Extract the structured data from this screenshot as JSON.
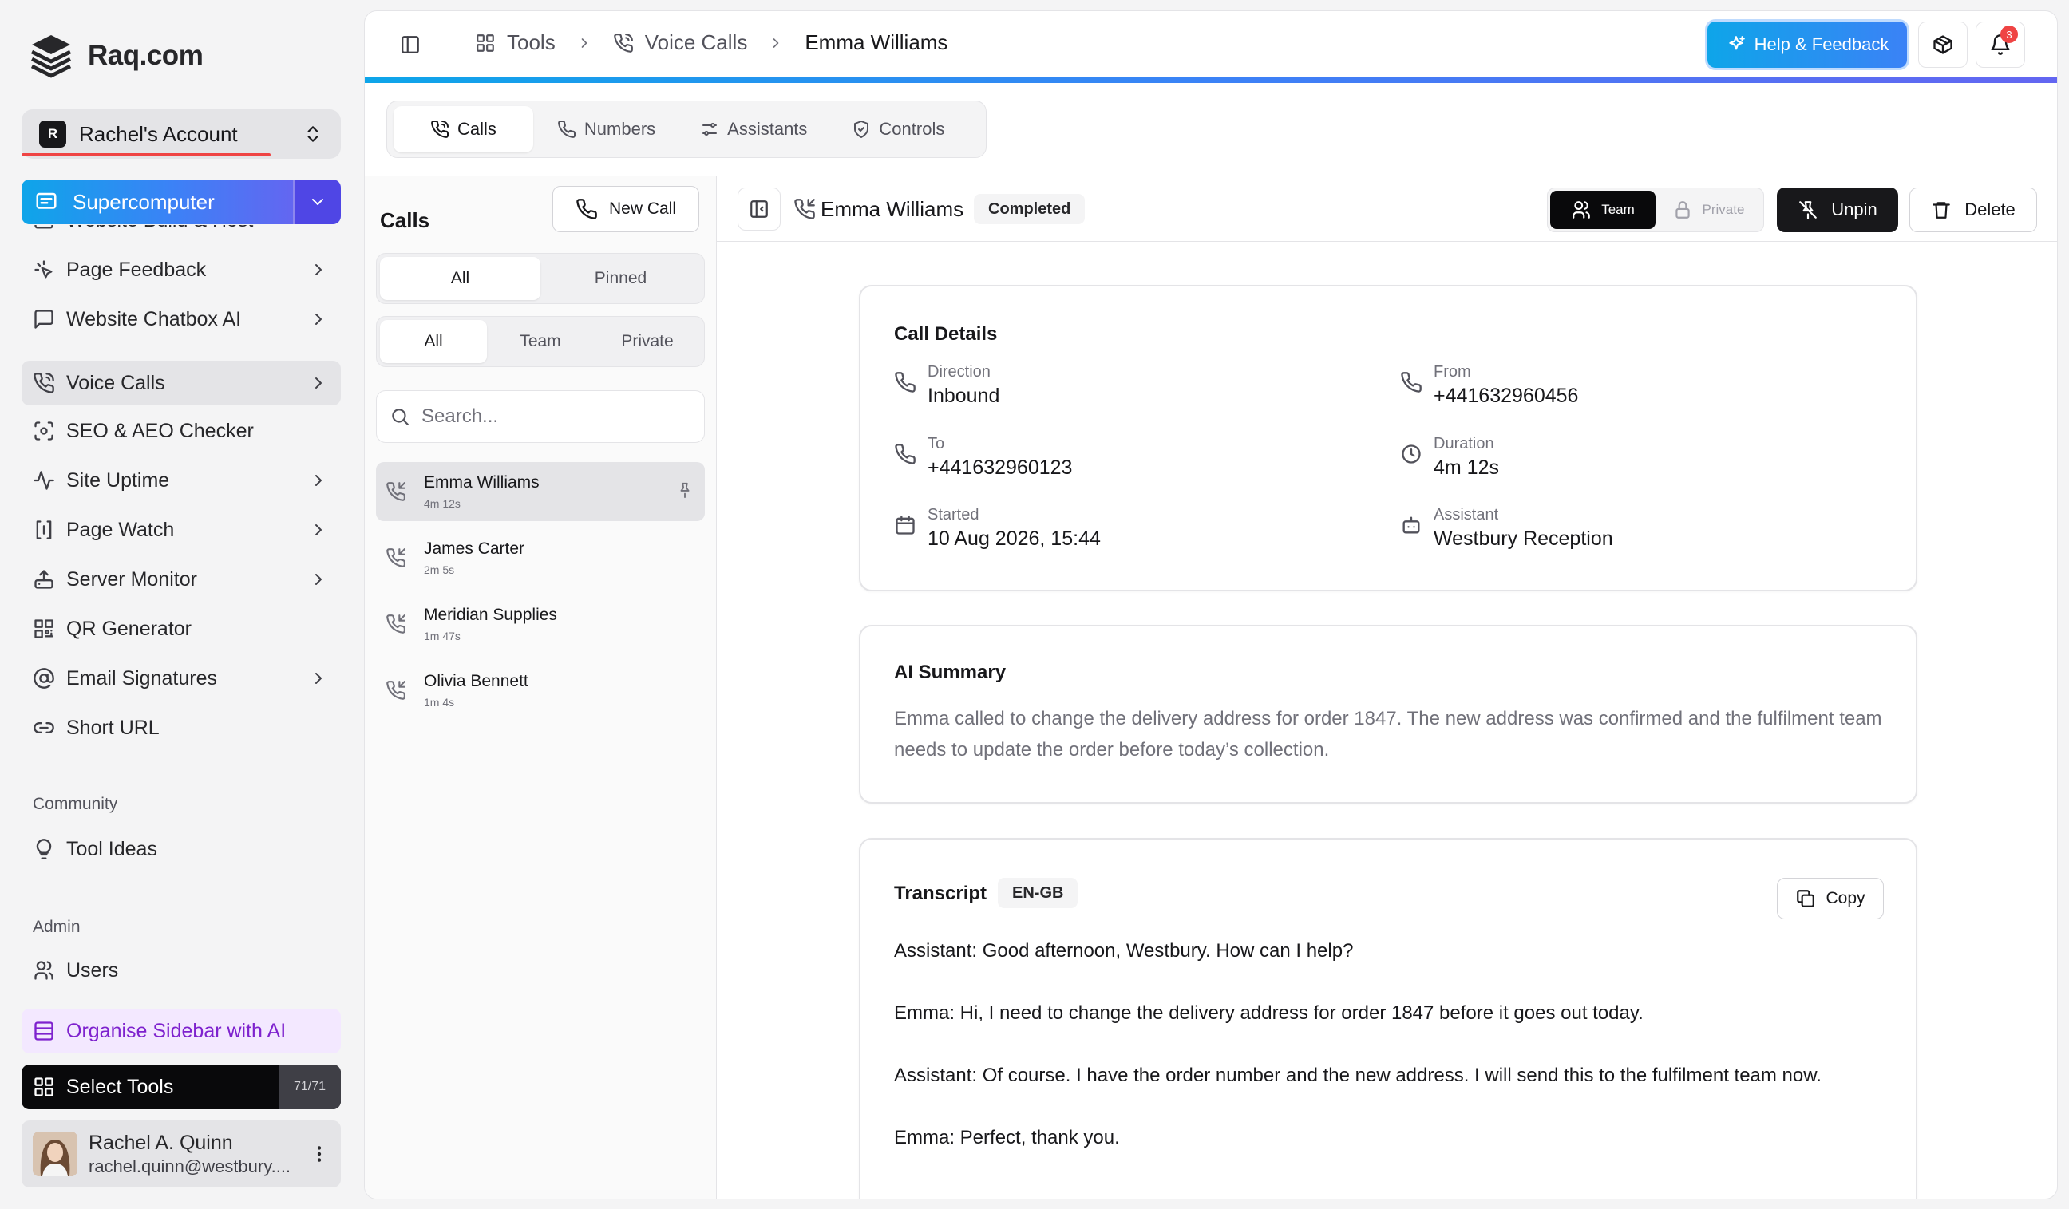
{
  "brand": {
    "name": "Raq.com"
  },
  "account": {
    "initial": "R",
    "name": "Rachel's Account"
  },
  "supercomputer": {
    "label": "Supercomputer"
  },
  "sidebar": {
    "items": [
      {
        "label": "Website Build & Host",
        "icon": "build-icon",
        "chevron": false,
        "active": false
      },
      {
        "label": "Page Feedback",
        "icon": "sparkle-cursor-icon",
        "chevron": true,
        "active": false
      },
      {
        "label": "Website Chatbox AI",
        "icon": "chat-bubble-icon",
        "chevron": true,
        "active": false
      },
      {
        "label": "Voice Calls",
        "icon": "phone-call-icon",
        "chevron": true,
        "active": true
      },
      {
        "label": "SEO & AEO Checker",
        "icon": "scan-search-icon",
        "chevron": false,
        "active": false
      },
      {
        "label": "Site Uptime",
        "icon": "activity-icon",
        "chevron": true,
        "active": false
      },
      {
        "label": "Page Watch",
        "icon": "brackets-icon",
        "chevron": true,
        "active": false
      },
      {
        "label": "Server Monitor",
        "icon": "server-icon",
        "chevron": true,
        "active": false
      },
      {
        "label": "QR Generator",
        "icon": "qr-code-icon",
        "chevron": false,
        "active": false
      },
      {
        "label": "Email Signatures",
        "icon": "at-sign-icon",
        "chevron": true,
        "active": false
      },
      {
        "label": "Short URL",
        "icon": "link-icon",
        "chevron": false,
        "active": false
      }
    ],
    "community": {
      "title": "Community",
      "items": [
        {
          "label": "Tool Ideas",
          "icon": "lightbulb-icon"
        }
      ]
    },
    "admin": {
      "title": "Admin",
      "items": [
        {
          "label": "Users",
          "icon": "users-icon"
        }
      ]
    },
    "organise_label": "Organise Sidebar with AI",
    "select_tools": {
      "label": "Select Tools",
      "count": "71/71"
    },
    "user": {
      "name": "Rachel A. Quinn",
      "email": "rachel.quinn@westbury...."
    }
  },
  "header": {
    "breadcrumbs": [
      "Tools",
      "Voice Calls",
      "Emma Williams"
    ],
    "help_label": "Help & Feedback",
    "notification_count": "3"
  },
  "tabs": [
    {
      "label": "Calls",
      "icon": "phone-call-icon",
      "active": true
    },
    {
      "label": "Numbers",
      "icon": "phone-icon",
      "active": false
    },
    {
      "label": "Assistants",
      "icon": "sliders-icon",
      "active": false
    },
    {
      "label": "Controls",
      "icon": "shield-check-icon",
      "active": false
    }
  ],
  "calls_list": {
    "title": "Calls",
    "new_call_label": "New Call",
    "filter_pin": [
      "All",
      "Pinned"
    ],
    "filter_scope": [
      "All",
      "Team",
      "Private"
    ],
    "search_placeholder": "Search...",
    "items": [
      {
        "name": "Emma Williams",
        "duration": "4m 12s",
        "pinned": true,
        "active": true
      },
      {
        "name": "James Carter",
        "duration": "2m 5s",
        "pinned": false,
        "active": false
      },
      {
        "name": "Meridian Supplies",
        "duration": "1m 47s",
        "pinned": false,
        "active": false
      },
      {
        "name": "Olivia Bennett",
        "duration": "1m 4s",
        "pinned": false,
        "active": false
      }
    ]
  },
  "detail": {
    "name": "Emma Williams",
    "status": "Completed",
    "visibility": {
      "team": "Team",
      "private": "Private",
      "selected": "Team"
    },
    "unpin_label": "Unpin",
    "delete_label": "Delete",
    "call_details": {
      "title": "Call Details",
      "direction": {
        "label": "Direction",
        "value": "Inbound"
      },
      "from": {
        "label": "From",
        "value": "+441632960456"
      },
      "to": {
        "label": "To",
        "value": "+441632960123"
      },
      "duration": {
        "label": "Duration",
        "value": "4m 12s"
      },
      "started": {
        "label": "Started",
        "value": "10 Aug 2026, 15:44"
      },
      "assistant": {
        "label": "Assistant",
        "value": "Westbury Reception"
      }
    },
    "summary": {
      "title": "AI Summary",
      "text": "Emma called to change the delivery address for order 1847. The new address was confirmed and the fulfilment team needs to update the order before today’s collection."
    },
    "transcript": {
      "title": "Transcript",
      "language": "EN-GB",
      "copy_label": "Copy",
      "lines": [
        "Assistant: Good afternoon, Westbury. How can I help?",
        "Emma: Hi, I need to change the delivery address for order 1847 before it goes out today.",
        "Assistant: Of course. I have the order number and the new address. I will send this to the fulfilment team now.",
        "Emma: Perfect, thank you."
      ]
    }
  },
  "colors": {
    "accent_gradient_start": "#0ea5e9",
    "accent_gradient_end": "#6366f1",
    "notification": "#ef4444",
    "organise_bg": "#f3e8ff",
    "organise_text": "#7e22ce"
  }
}
